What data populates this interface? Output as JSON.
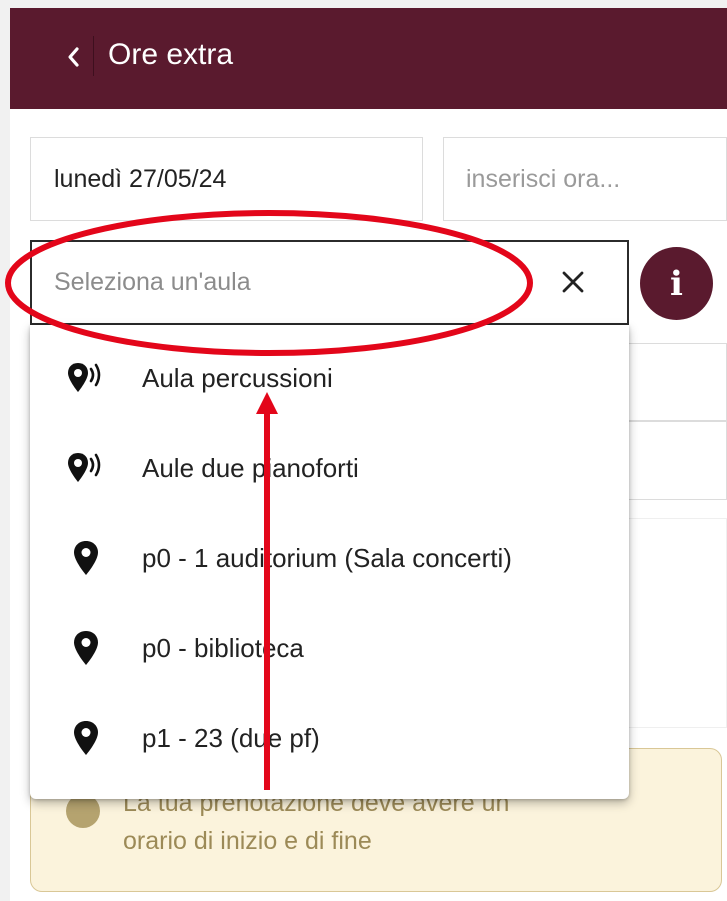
{
  "header": {
    "title": "Ore extra",
    "back_icon": "chevron-left-icon"
  },
  "date_field": {
    "value": "lunedì 27/05/24"
  },
  "time_field": {
    "placeholder": "inserisci ora..."
  },
  "room_select": {
    "placeholder": "Seleziona un'aula",
    "clear_icon": "close-icon"
  },
  "info_button": {
    "label": "i"
  },
  "dropdown": {
    "items": [
      {
        "label": "Aula percussioni",
        "icon": "location-sound-icon"
      },
      {
        "label": "Aule due pianoforti",
        "icon": "location-sound-icon"
      },
      {
        "label": "p0 - 1 auditorium (Sala concerti)",
        "icon": "location-pin-icon"
      },
      {
        "label": "p0 - biblioteca",
        "icon": "location-pin-icon"
      },
      {
        "label": "p1 - 23 (due pf)",
        "icon": "location-pin-icon"
      }
    ]
  },
  "alert": {
    "line1": "La tua prenotazione deve avere un",
    "line2": "orario di inizio e di fine"
  },
  "colors": {
    "brand": "#5a1a2e",
    "annotation": "#e3061a",
    "alert_bg": "#fbf3dc",
    "alert_text": "#9c8a57"
  }
}
